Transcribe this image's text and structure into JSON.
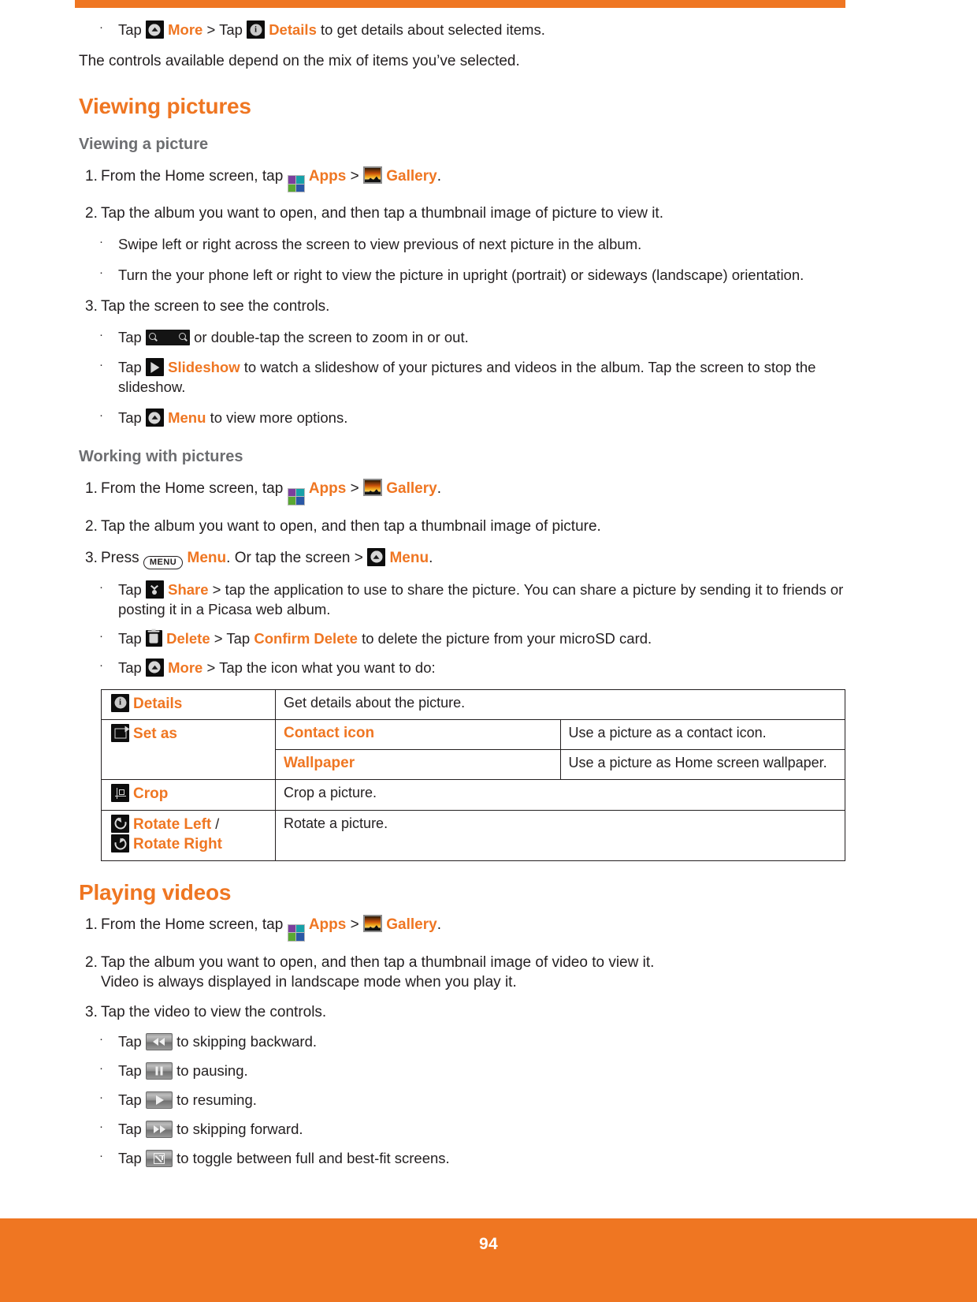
{
  "theme": {
    "orange": "#EF7622",
    "heading_gray": "#6d6e71",
    "body": "#231f20"
  },
  "page_number": "94",
  "intro": {
    "bullet_more_details": {
      "tap_1": "Tap",
      "more_label": "More",
      "gt": ">",
      "tap_2": "Tap",
      "details_label": "Details",
      "rest": "to get details about selected items."
    },
    "paragraph": "The controls available depend on the mix of items you’ve selected."
  },
  "viewing_pictures": {
    "title": "Viewing pictures",
    "subsection_1": {
      "title": "Viewing a picture",
      "step1": {
        "num": "1.",
        "lead": "From the Home screen, tap",
        "apps_label": "Apps",
        "gt": ">",
        "gallery_label": "Gallery",
        "period": "."
      },
      "step2": {
        "num": "2.",
        "text": "Tap the album you want to open, and then tap a thumbnail image of picture to view it."
      },
      "bullet_swipe": "Swipe left or right across the screen to view previous of next picture in the album.",
      "bullet_turn": "Turn the your phone left or right to view the picture in upright (portrait) or sideways (landscape) orientation.",
      "step3": {
        "num": "3.",
        "text": "Tap the screen to see the controls."
      },
      "bullet_zoom": {
        "tap": "Tap",
        "rest": "or double-tap the screen to zoom in or out."
      },
      "bullet_slideshow": {
        "tap": "Tap",
        "label": "Slideshow",
        "rest": "to watch a slideshow of your pictures and videos in the album. Tap the screen to stop the slideshow."
      },
      "bullet_menu": {
        "tap": "Tap",
        "label": "Menu",
        "rest": "to view more options."
      }
    },
    "subsection_2": {
      "title": "Working with pictures",
      "step1": {
        "num": "1.",
        "lead": "From the Home screen, tap",
        "apps_label": "Apps",
        "gt": ">",
        "gallery_label": "Gallery",
        "period": "."
      },
      "step2": {
        "num": "2.",
        "text": "Tap the album you want to open, and then tap a thumbnail image of picture."
      },
      "step3": {
        "num": "3.",
        "press": "Press",
        "key_label": "MENU",
        "menu_label": "Menu",
        "mid": ". Or tap the screen",
        "gt": ">",
        "menu_label_2": "Menu",
        "period": "."
      },
      "bullet_share": {
        "tap": "Tap",
        "label": "Share",
        "rest": "> tap the application to use to share the picture. You can share a picture by sending it to friends or posting it in a Picasa web album."
      },
      "bullet_delete": {
        "tap": "Tap",
        "label": "Delete",
        "mid": "> Tap",
        "confirm_label": "Confirm Delete",
        "rest": "to delete the picture from your microSD card."
      },
      "bullet_more": {
        "tap": "Tap",
        "label": "More",
        "rest": "> Tap the icon what you want to do:"
      }
    },
    "options_table": {
      "rows": [
        {
          "icon": "info-icon",
          "label": "Details",
          "sub": null,
          "desc": "Get details about the picture."
        },
        {
          "icon": "set-as-icon",
          "label": "Set as",
          "sub": [
            {
              "name": "Contact icon",
              "desc": "Use a picture as a contact icon."
            },
            {
              "name": "Wallpaper",
              "desc": "Use a picture as Home screen wallpaper."
            }
          ],
          "desc": null
        },
        {
          "icon": "crop-icon",
          "label": "Crop",
          "sub": null,
          "desc": "Crop a picture."
        },
        {
          "icon": "rotate-icon",
          "label": "Rotate Left",
          "label_sep": "/",
          "label_2": "Rotate Right",
          "sub": null,
          "desc": "Rotate a picture."
        }
      ]
    }
  },
  "playing_videos": {
    "title": "Playing videos",
    "step1": {
      "num": "1.",
      "lead": "From the Home screen, tap",
      "apps_label": "Apps",
      "gt": ">",
      "gallery_label": "Gallery",
      "period": "."
    },
    "step2": {
      "num": "2.",
      "line1": "Tap the album you want to open, and then tap a thumbnail image of video to view it.",
      "line2": "Video is always displayed in landscape mode when you play it."
    },
    "step3": {
      "num": "3.",
      "text": "Tap the video to view the controls."
    },
    "bullets": [
      {
        "tap": "Tap",
        "icon": "rewind-icon",
        "rest": "to skipping backward."
      },
      {
        "tap": "Tap",
        "icon": "pause-icon",
        "rest": "to pausing."
      },
      {
        "tap": "Tap",
        "icon": "play-icon",
        "rest": "to resuming."
      },
      {
        "tap": "Tap",
        "icon": "fast-forward-icon",
        "rest": "to skipping forward."
      },
      {
        "tap": "Tap",
        "icon": "fullscreen-icon",
        "rest": "to toggle between full and best-fit screens."
      }
    ]
  }
}
